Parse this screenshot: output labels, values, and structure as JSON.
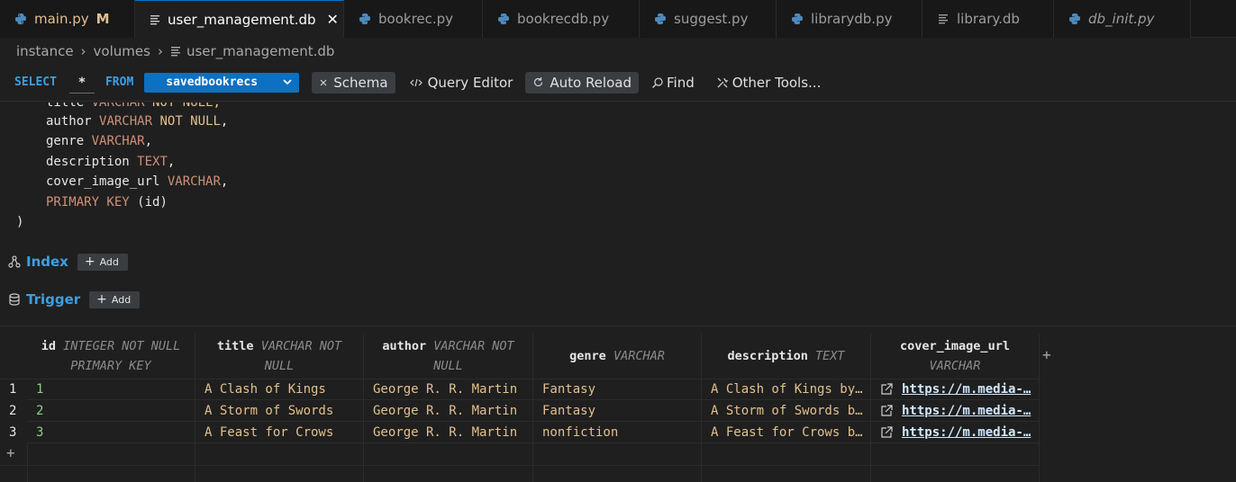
{
  "tabs": [
    {
      "label": "main.py",
      "icon": "python-icon",
      "badge": "M",
      "state": "modified"
    },
    {
      "label": "user_management.db",
      "icon": "file-lines-icon",
      "state": "active",
      "close": "✕"
    },
    {
      "label": "bookrec.py",
      "icon": "python-icon",
      "state": "normal"
    },
    {
      "label": "bookrecdb.py",
      "icon": "python-icon",
      "state": "normal"
    },
    {
      "label": "suggest.py",
      "icon": "python-icon",
      "state": "normal"
    },
    {
      "label": "librarydb.py",
      "icon": "python-icon",
      "state": "normal"
    },
    {
      "label": "library.db",
      "icon": "file-lines-icon",
      "state": "normal"
    },
    {
      "label": "db_init.py",
      "icon": "python-icon",
      "state": "italic"
    }
  ],
  "breadcrumb": [
    "instance",
    "volumes",
    "user_management.db"
  ],
  "toolbar": {
    "select_kw": "SELECT",
    "columns_value": "*",
    "from_kw": "FROM",
    "table_name": "savedbookrecs",
    "schema_label": "Schema",
    "query_editor_label": "Query Editor",
    "auto_reload_label": "Auto Reload",
    "find_label": "Find",
    "other_tools_label": "Other Tools..."
  },
  "schema_code": {
    "partial_line": {
      "name": "title",
      "type": "VARCHAR",
      "constraint": "NOT NULL,"
    },
    "lines": [
      {
        "name": "author",
        "type": "VARCHAR",
        "constraint": "NOT NULL",
        "end": ","
      },
      {
        "name": "genre",
        "type": "VARCHAR",
        "constraint": "",
        "end": ","
      },
      {
        "name": "description",
        "type": "TEXT",
        "constraint": "",
        "end": ","
      },
      {
        "name": "cover_image_url",
        "type": "VARCHAR",
        "constraint": "",
        "end": ","
      }
    ],
    "pk_keyword": "PRIMARY KEY",
    "pk_cols": "(id)",
    "close_paren": ")"
  },
  "sections": {
    "index_label": "Index",
    "trigger_label": "Trigger",
    "add_label": "Add"
  },
  "grid": {
    "columns": [
      {
        "name": "id",
        "type": "INTEGER NOT NULL",
        "type2": "PRIMARY KEY"
      },
      {
        "name": "title",
        "type": "VARCHAR NOT",
        "type2": "NULL"
      },
      {
        "name": "author",
        "type": "VARCHAR NOT",
        "type2": "NULL"
      },
      {
        "name": "genre",
        "type": "VARCHAR",
        "type2": ""
      },
      {
        "name": "description",
        "type": "TEXT",
        "type2": ""
      },
      {
        "name": "cover_image_url",
        "type": "",
        "type2": "VARCHAR"
      }
    ],
    "rows": [
      {
        "num": "1",
        "id": "1",
        "title": "A Clash of Kings",
        "author": "George R. R. Martin",
        "genre": "Fantasy",
        "description": "A Clash of Kings by…",
        "cover": "https://m.media-…"
      },
      {
        "num": "2",
        "id": "2",
        "title": "A Storm of Swords",
        "author": "George R. R. Martin",
        "genre": "Fantasy",
        "description": "A Storm of Swords b…",
        "cover": "https://m.media-…"
      },
      {
        "num": "3",
        "id": "3",
        "title": "A Feast for Crows",
        "author": "George R. R. Martin",
        "genre": "nonfiction",
        "description": "A Feast for Crows b…",
        "cover": "https://m.media-…"
      }
    ],
    "add_column": "+",
    "add_row": "+"
  },
  "colors": {
    "accent": "#0e70c0",
    "keyword": "#3e9fe0",
    "string_value": "#e2c08d",
    "id_value": "#89d185",
    "type_value": "#ce9178",
    "background": "#1f1f1f"
  }
}
